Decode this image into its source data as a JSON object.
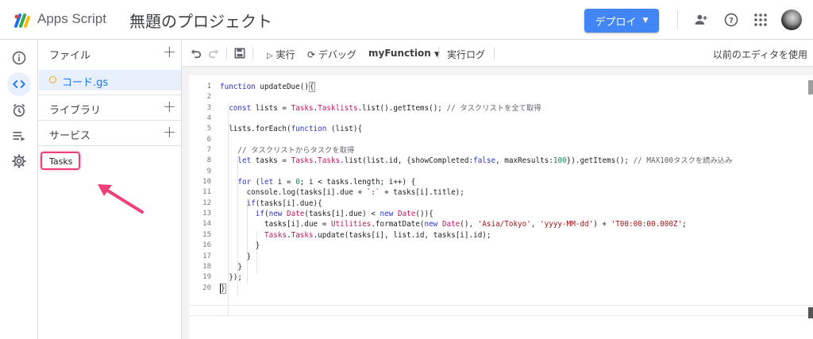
{
  "header": {
    "app_name": "Apps Script",
    "project_title": "無題のプロジェクト",
    "deploy_label": "デプロイ"
  },
  "rail": [
    "overview-icon",
    "editor-icon",
    "triggers-icon",
    "executions-icon",
    "settings-icon"
  ],
  "files_panel": {
    "files_label": "ファイル",
    "file_name": "コード.gs",
    "libraries_label": "ライブラリ",
    "services_label": "サービス",
    "service_item": "Tasks"
  },
  "toolbar": {
    "run_label": "実行",
    "debug_label": "デバッグ",
    "function_name": "myFunction",
    "log_label": "実行ログ",
    "legacy_editor_label": "以前のエディタを使用"
  },
  "code": {
    "line_numbers": [
      "1",
      "2",
      "3",
      "4",
      "5",
      "6",
      "7",
      "8",
      "9",
      "10",
      "11",
      "12",
      "13",
      "14",
      "15",
      "16",
      "17",
      "18",
      "19",
      "20"
    ]
  },
  "colors": {
    "accent": "#4285f4",
    "highlight": "#f0407a",
    "active_bg": "#e8f0fe"
  }
}
